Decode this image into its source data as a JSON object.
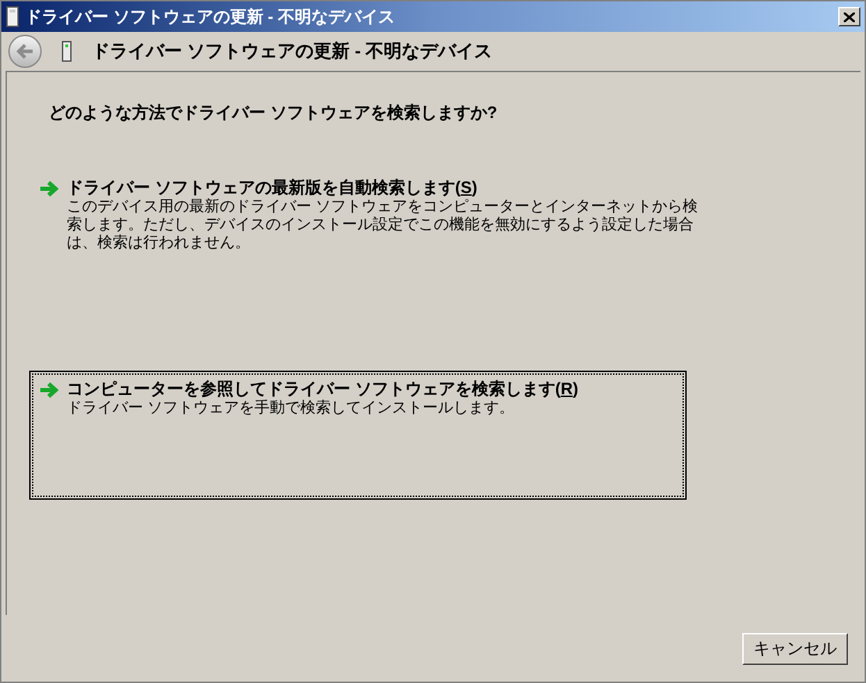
{
  "window": {
    "title": "ドライバー ソフトウェアの更新 - 不明なデバイス"
  },
  "header": {
    "title": "ドライバー ソフトウェアの更新 - 不明なデバイス"
  },
  "question": "どのような方法でドライバー ソフトウェアを検索しますか?",
  "options": [
    {
      "label_parts": [
        "ドライバー ソフトウェアの最新版を自動検索します(",
        "S",
        ")"
      ],
      "description": "このデバイス用の最新のドライバー ソフトウェアをコンピューターとインターネットから検索します。ただし、デバイスのインストール設定でこの機能を無効にするよう設定した場合は、検索は行われません。",
      "selected": false
    },
    {
      "label_parts": [
        "コンピューターを参照してドライバー ソフトウェアを検索します(",
        "R",
        ")"
      ],
      "description": "ドライバー ソフトウェアを手動で検索してインストールします。",
      "selected": true
    }
  ],
  "buttons": [
    {
      "label": "キャンセル"
    }
  ]
}
